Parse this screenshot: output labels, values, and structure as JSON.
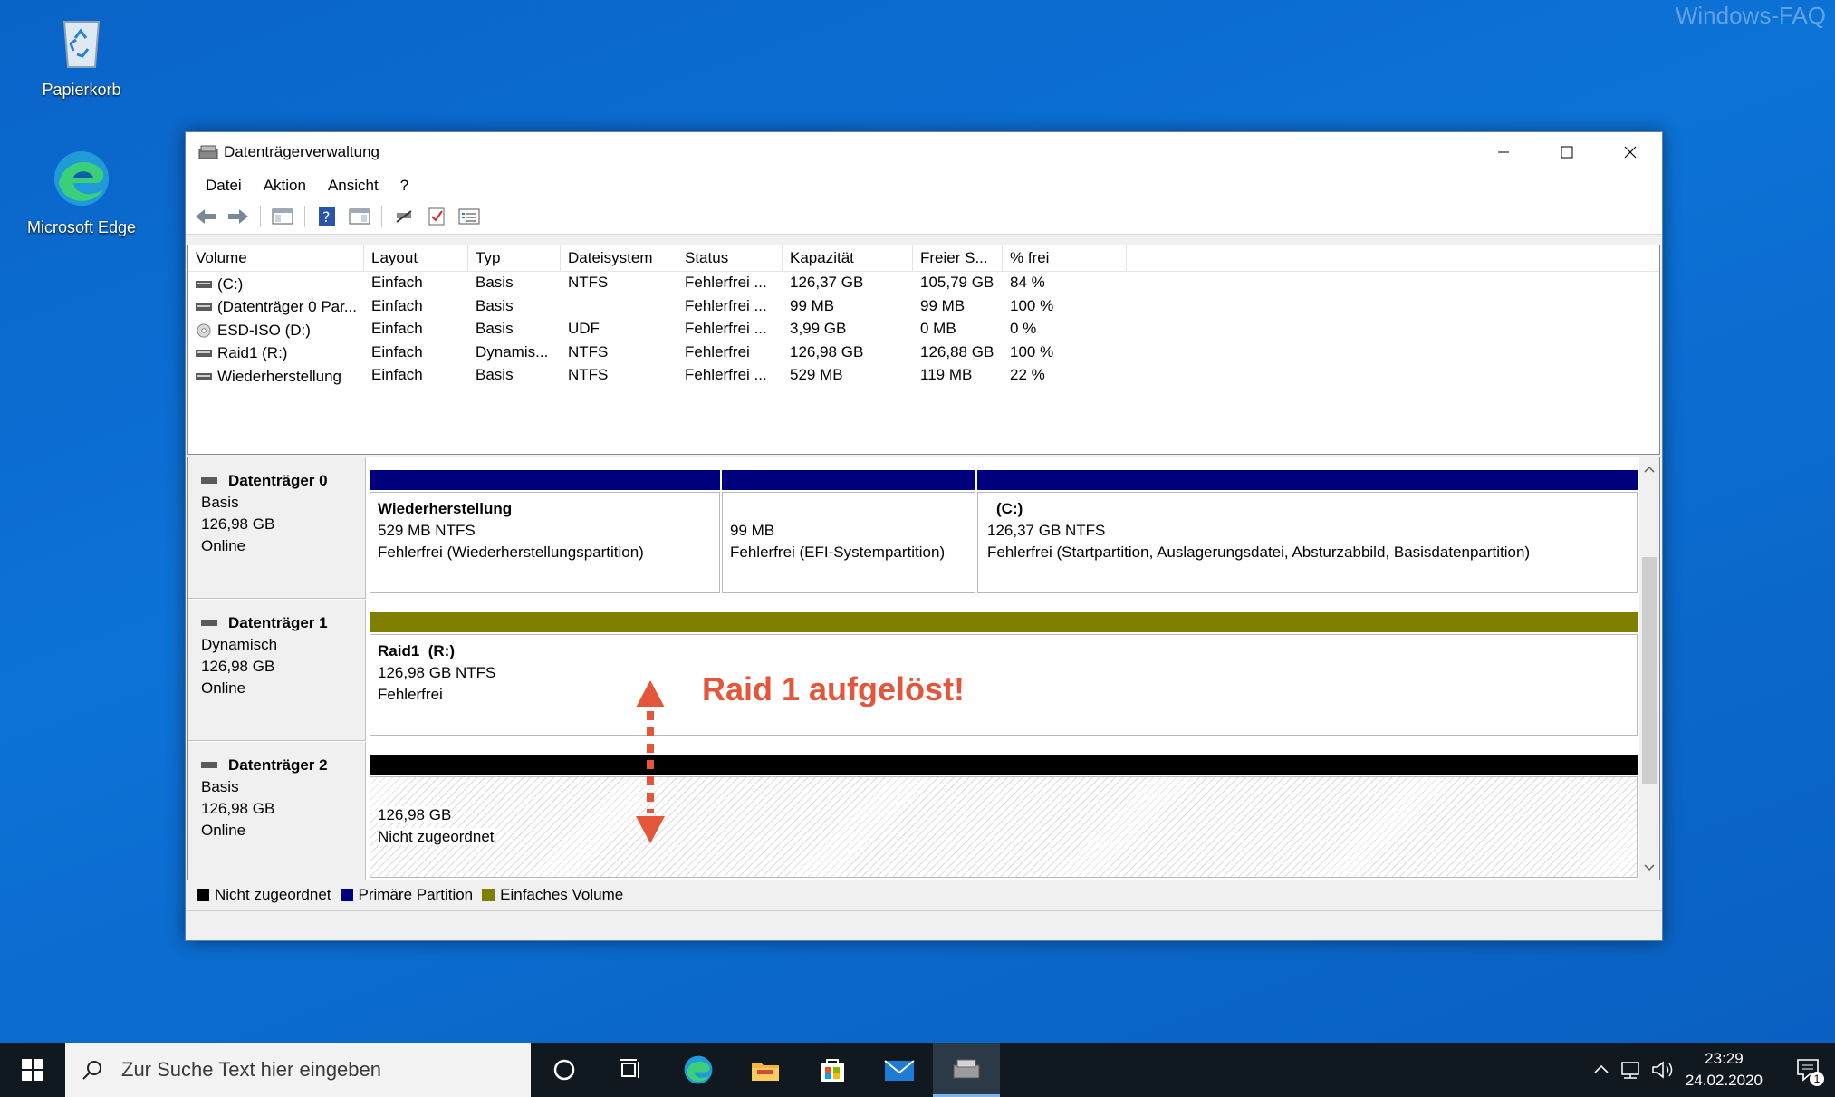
{
  "desktop": {
    "watermark": "Windows-FAQ",
    "icons": [
      {
        "label": "Papierkorb",
        "icon": "recycle-bin-icon"
      },
      {
        "label": "Microsoft Edge",
        "icon": "edge-icon"
      }
    ]
  },
  "window": {
    "title": "Datenträgerverwaltung",
    "menu": [
      "Datei",
      "Aktion",
      "Ansicht",
      "?"
    ],
    "toolbar_icons": [
      "back-arrow-icon",
      "forward-arrow-icon",
      "console-tree-icon",
      "help-icon",
      "properties-icon",
      "connect-icon",
      "check-icon",
      "list-icon"
    ]
  },
  "volumes": {
    "columns": [
      "Volume",
      "Layout",
      "Typ",
      "Dateisystem",
      "Status",
      "Kapazität",
      "Freier S...",
      "% frei"
    ],
    "rows": [
      [
        "(C:)",
        "Einfach",
        "Basis",
        "NTFS",
        "Fehlerfrei ...",
        "126,37 GB",
        "105,79 GB",
        "84 %"
      ],
      [
        "(Datenträger 0 Par...",
        "Einfach",
        "Basis",
        "",
        "Fehlerfrei ...",
        "99 MB",
        "99 MB",
        "100 %"
      ],
      [
        "ESD-ISO (D:)",
        "Einfach",
        "Basis",
        "UDF",
        "Fehlerfrei ...",
        "3,99 GB",
        "0 MB",
        "0 %"
      ],
      [
        "Raid1 (R:)",
        "Einfach",
        "Dynamis...",
        "NTFS",
        "Fehlerfrei",
        "126,98 GB",
        "126,88 GB",
        "100 %"
      ],
      [
        "Wiederherstellung",
        "Einfach",
        "Basis",
        "NTFS",
        "Fehlerfrei ...",
        "529 MB",
        "119 MB",
        "22 %"
      ]
    ]
  },
  "disks": [
    {
      "name": "Datenträger 0",
      "type": "Basis",
      "size": "126,98 GB",
      "state": "Online",
      "partitions": [
        {
          "title": "Wiederherstellung",
          "line1": "529 MB NTFS",
          "line2": "Fehlerfrei (Wiederherstellungspartition)",
          "kind": "primary"
        },
        {
          "title": "",
          "line1": "99 MB",
          "line2": "Fehlerfrei (EFI-Systempartition)",
          "kind": "primary"
        },
        {
          "title": "(C:)",
          "line1": "126,37 GB NTFS",
          "line2": "Fehlerfrei (Startpartition, Auslagerungsdatei, Absturzabbild, Basisdatenpartition)",
          "kind": "primary"
        }
      ]
    },
    {
      "name": "Datenträger 1",
      "type": "Dynamisch",
      "size": "126,98 GB",
      "state": "Online",
      "partitions": [
        {
          "title": "Raid1  (R:)",
          "line1": "126,98 GB NTFS",
          "line2": "Fehlerfrei",
          "kind": "simple"
        }
      ]
    },
    {
      "name": "Datenträger 2",
      "type": "Basis",
      "size": "126,98 GB",
      "state": "Online",
      "partitions": [
        {
          "title": "",
          "line1": "126,98 GB",
          "line2": "Nicht zugeordnet",
          "kind": "unallocated"
        }
      ]
    }
  ],
  "legend": [
    {
      "label": "Nicht zugeordnet",
      "color": "#000000"
    },
    {
      "label": "Primäre Partition",
      "color": "#00007f"
    },
    {
      "label": "Einfaches Volume",
      "color": "#808000"
    }
  ],
  "annotation": {
    "text": "Raid 1 aufgelöst!",
    "color": "#e4553a"
  },
  "taskbar": {
    "search_placeholder": "Zur Suche Text hier eingeben",
    "time": "23:29",
    "date": "24.02.2020",
    "notification_count": "1"
  }
}
